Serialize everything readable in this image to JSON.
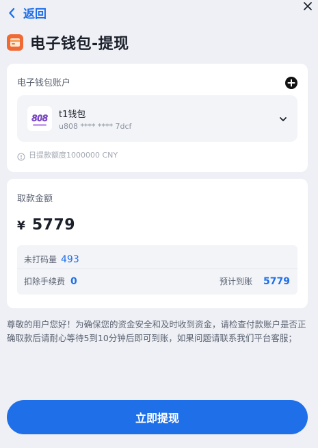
{
  "header": {
    "back_label": "返回",
    "title": "电子钱包-提现"
  },
  "account": {
    "section_label": "电子钱包账户",
    "wallet_name": "t1钱包",
    "wallet_number": "u808 **** **** 7dcf",
    "daily_limit": "日提款额度1000000 CNY",
    "logo_text": "808"
  },
  "amount": {
    "section_label": "取款金额",
    "currency_symbol": "¥",
    "value": "5779",
    "unplayed_label": "未打码量",
    "unplayed_value": "493",
    "fee_label": "扣除手续费",
    "fee_value": "0",
    "expected_label": "预计到账",
    "expected_value": "5779"
  },
  "notice": "尊敬的用户您好！为确保您的资金安全和及时收到资金，请检查付款账户是否正确取款后请耐心等待5到10分钟后即可到账，如果问题请联系我们平台客服；",
  "submit_label": "立即提现",
  "colors": {
    "accent": "#1f6fe8",
    "background": "#eef0f5",
    "card": "#ffffff"
  }
}
